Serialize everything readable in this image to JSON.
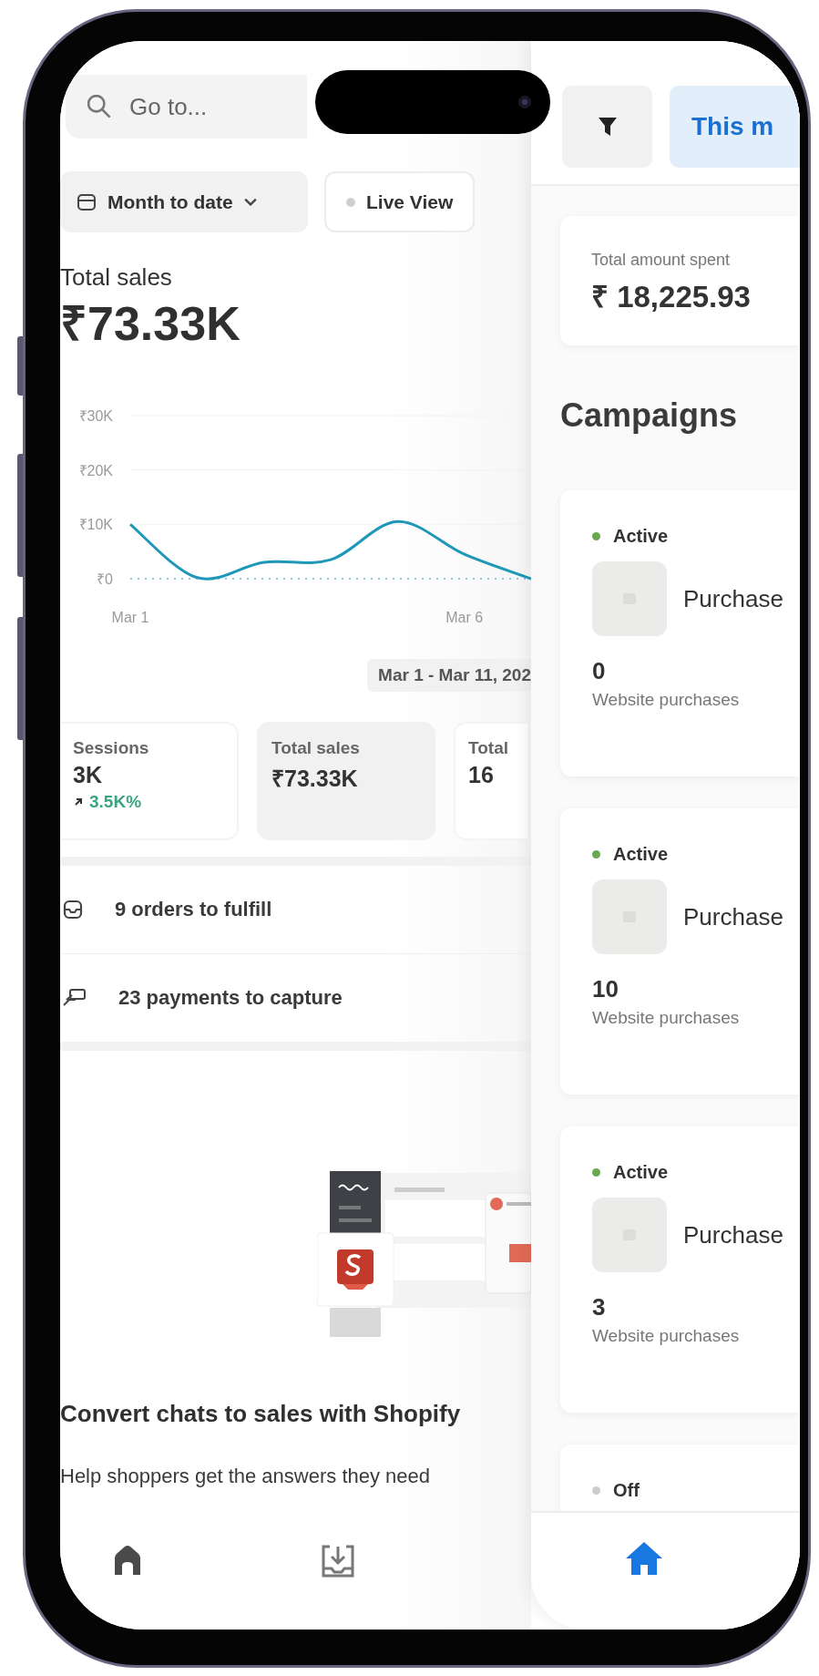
{
  "home_screen": {
    "search": {
      "placeholder": "Go to..."
    },
    "date_filter": {
      "label": "Month to date"
    },
    "live_view": {
      "label": "Live View"
    },
    "total_sales": {
      "label": "Total sales",
      "value": "₹73.33K"
    },
    "chart": {
      "chart_data": {
        "type": "line",
        "categories": [
          "Mar 1",
          null,
          null,
          null,
          null,
          "Mar 6",
          null
        ],
        "series": [
          {
            "color": "#1f97b8",
            "values": [
              10000,
              200,
              3000,
              3500,
              10500,
              4500,
              0
            ]
          }
        ],
        "ylim": [
          0,
          30000
        ],
        "yticks": [
          {
            "value": 0,
            "label": "₹0"
          },
          {
            "value": 10000,
            "label": "₹10K"
          },
          {
            "value": 20000,
            "label": "₹20K"
          },
          {
            "value": 30000,
            "label": "₹30K"
          }
        ]
      }
    },
    "date_range": "Mar 1 - Mar 11, 202",
    "metrics": [
      {
        "label": "Sessions",
        "value": "3K",
        "change": "3.5K%",
        "selected": false
      },
      {
        "label": "Total sales",
        "value": "₹73.33K",
        "selected": true
      },
      {
        "label": "Total",
        "value": "16",
        "selected": false
      }
    ],
    "tasks": [
      {
        "kind": "orders",
        "text": "9 orders to fulfill"
      },
      {
        "kind": "payments",
        "text": "23 payments to capture"
      }
    ],
    "promo": {
      "title": "Convert chats to sales with Shopify",
      "body": "Help shoppers get the answers they need"
    }
  },
  "ads_screen": {
    "date_chip": "This m",
    "total_spent": {
      "label": "Total amount spent",
      "value": "₹ 18,225.93"
    },
    "heading": "Campaigns",
    "campaigns": [
      {
        "status": "Active",
        "on": true,
        "name": "Purchase",
        "count": "0",
        "metric": "Website purchases"
      },
      {
        "status": "Active",
        "on": true,
        "name": "Purchase",
        "count": "10",
        "metric": "Website purchases"
      },
      {
        "status": "Active",
        "on": true,
        "name": "Purchase",
        "count": "3",
        "metric": "Website purchases"
      },
      {
        "status": "Off",
        "on": false
      }
    ]
  }
}
